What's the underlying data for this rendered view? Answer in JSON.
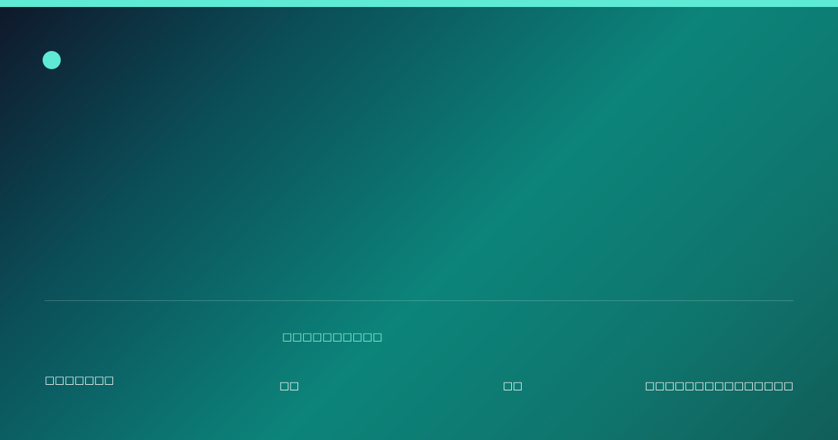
{
  "colors": {
    "accent": "#5eead4",
    "highlight_text": "#99f6e4",
    "text": "#ffffff",
    "gradient_start": "#0f172a",
    "gradient_mid": "#0c847a",
    "gradient_end": "#115e59"
  },
  "footer": {
    "highlight": "□□□□□□□□□□",
    "left_label": "□□□□□□□",
    "meta_1": "□□",
    "meta_2": "□□",
    "right_label": "□□□□□□□□□□□□□□□"
  },
  "icons": {
    "brand": "accent-dot-icon"
  }
}
